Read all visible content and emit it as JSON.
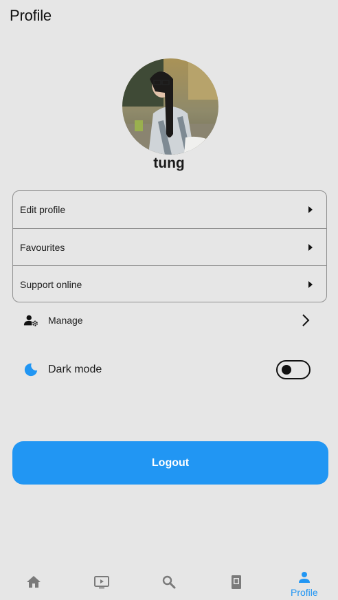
{
  "header": {
    "title": "Profile"
  },
  "profile": {
    "username": "tung"
  },
  "menu": {
    "items": [
      {
        "label": "Edit profile"
      },
      {
        "label": "Favourites"
      },
      {
        "label": "Support online"
      }
    ]
  },
  "manage": {
    "label": "Manage",
    "icon": "manage-accounts-icon"
  },
  "dark_mode": {
    "label": "Dark mode",
    "icon": "moon-icon",
    "enabled": false
  },
  "logout": {
    "label": "Logout"
  },
  "bottom_nav": {
    "items": [
      {
        "icon": "home-icon",
        "label": ""
      },
      {
        "icon": "video-icon",
        "label": ""
      },
      {
        "icon": "search-icon",
        "label": ""
      },
      {
        "icon": "book-icon",
        "label": ""
      },
      {
        "icon": "person-icon",
        "label": "Profile",
        "active": true
      }
    ]
  },
  "colors": {
    "accent": "#2196f3",
    "background": "#e6e6e6"
  }
}
